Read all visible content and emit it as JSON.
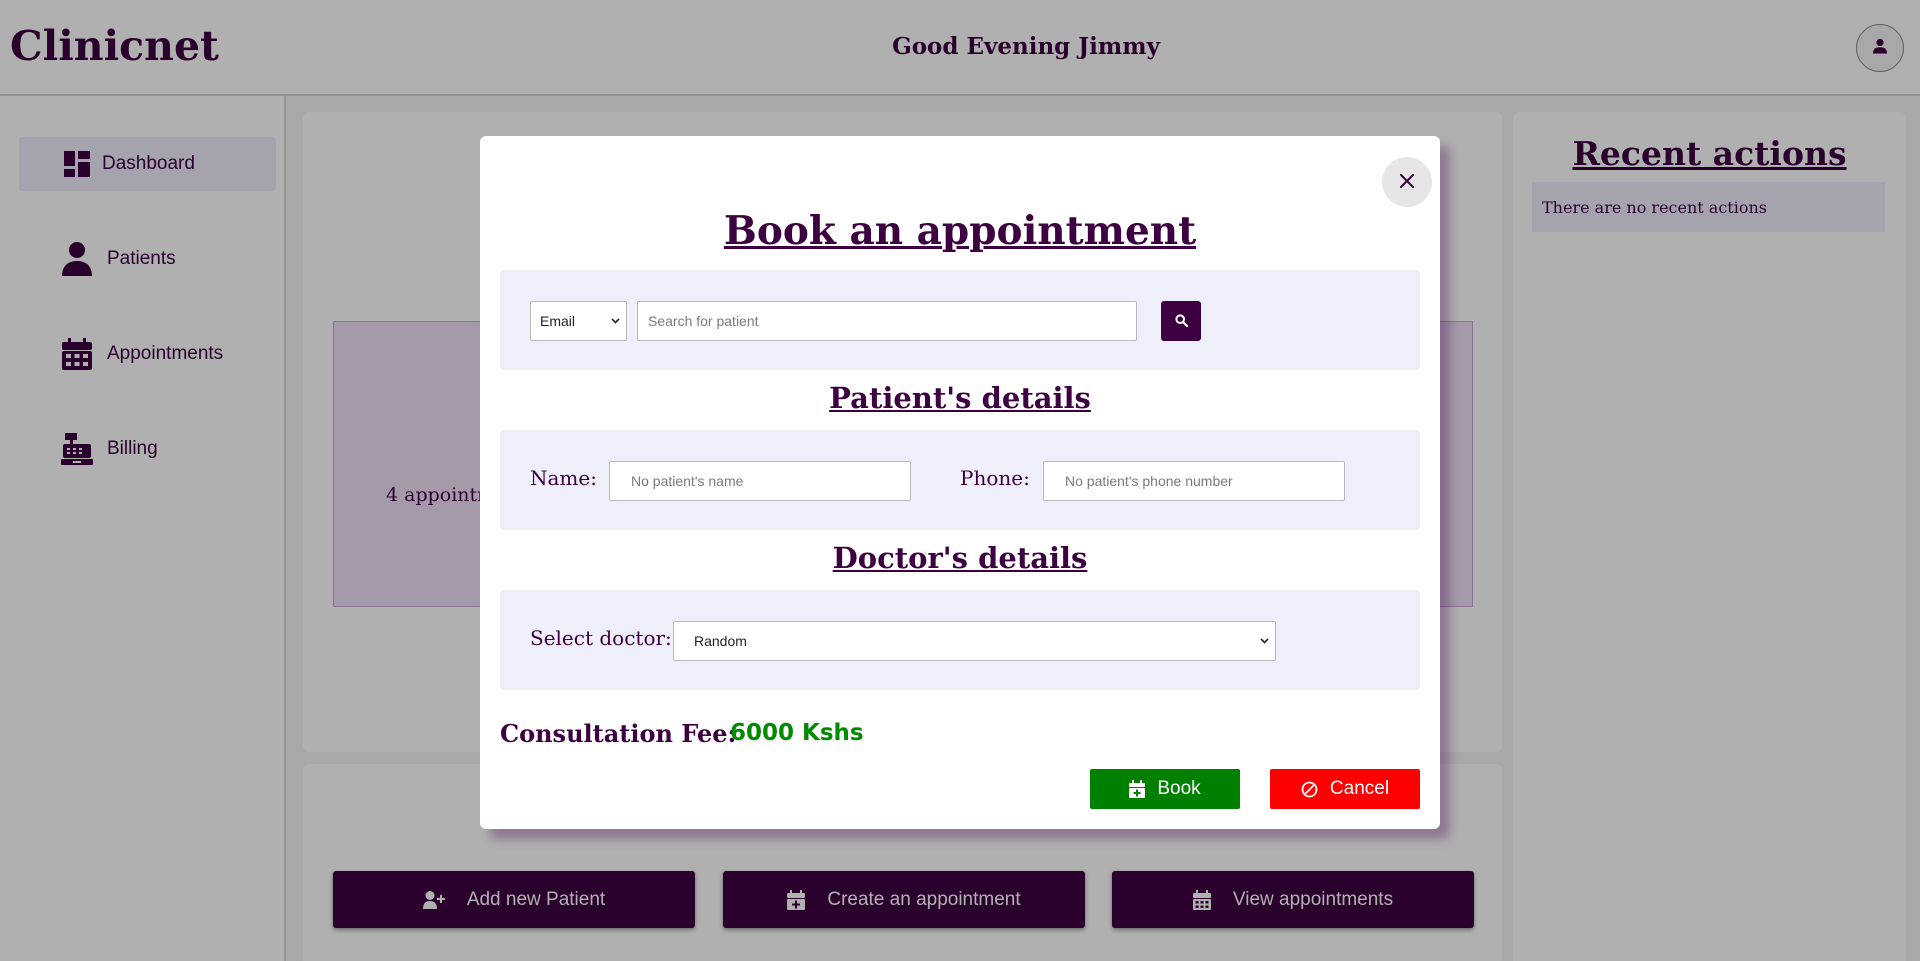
{
  "header": {
    "brand": "Clinicnet",
    "greeting": "Good Evening Jimmy",
    "profile_icon": "user-icon"
  },
  "sidebar": {
    "items": [
      {
        "label": "Dashboard",
        "icon": "dashboard-icon",
        "active": true
      },
      {
        "label": "Patients",
        "icon": "user-icon",
        "active": false
      },
      {
        "label": "Appointments",
        "icon": "calendar-icon",
        "active": false
      },
      {
        "label": "Billing",
        "icon": "cash-register-icon",
        "active": false
      }
    ]
  },
  "main": {
    "summary_text": "4 appointr",
    "actions": [
      {
        "label": "Add new Patient",
        "icon": "user-plus-icon"
      },
      {
        "label": "Create an appointment",
        "icon": "calendar-plus-icon"
      },
      {
        "label": "View appointments",
        "icon": "calendar-icon"
      }
    ]
  },
  "recent": {
    "title": "Recent actions",
    "empty_text": "There are no recent actions"
  },
  "modal": {
    "title": "Book an appointment",
    "search": {
      "type_selected": "Email",
      "placeholder": "Search for patient",
      "button_icon": "search-icon"
    },
    "patient_section": {
      "title": "Patient's details",
      "name_label": "Name:",
      "name_placeholder": "No patient's name",
      "phone_label": "Phone:",
      "phone_placeholder": "No patient's phone number"
    },
    "doctor_section": {
      "title": "Doctor's details",
      "select_label": "Select doctor:",
      "selected": "Random"
    },
    "fee_label": "Consultation Fee:",
    "fee_value": "6000 Kshs",
    "book_label": "Book",
    "cancel_label": "Cancel",
    "close_icon": "close-icon"
  },
  "colors": {
    "brand": "#3d0040",
    "panel": "#efeffc",
    "book": "#008000",
    "cancel": "#ff0000",
    "fee": "#008a00"
  }
}
